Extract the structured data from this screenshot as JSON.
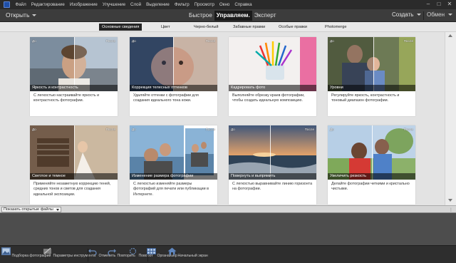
{
  "menubar": {
    "items": [
      "Файл",
      "Редактирование",
      "Изображение",
      "Улучшение",
      "Слой",
      "Выделение",
      "Фильтр",
      "Просмотр",
      "Окно",
      "Справка"
    ],
    "window_controls": [
      "–",
      "□",
      "✕"
    ]
  },
  "toolbar": {
    "open_label": "Открыть",
    "modes": [
      "Быстрое",
      "Управляем.",
      "Эксперт"
    ],
    "active_mode": "Управляем.",
    "create_label": "Создать",
    "share_label": "Обмен"
  },
  "tabs": [
    "Основные сведения",
    "Цвет",
    "Черно-белый",
    "Забавные правки",
    "Особые правки",
    "Photomerge"
  ],
  "active_tab": "Основные сведения",
  "cards": [
    {
      "title": "Яркость и контрастность",
      "desc": "С легкостью настраивайте яркость и контрастность фотографии.",
      "before": "До",
      "after": "После",
      "icon": "portrait-photo"
    },
    {
      "title": "Коррекция телесных оттенков",
      "desc": "Удаляйте оттенки с фотографии для создания идеального тона кожи.",
      "before": "До",
      "after": "После",
      "icon": "baby-photo"
    },
    {
      "title": "Кадрировать фото",
      "desc": "Выполняйте обрезку краев фотографии, чтобы создать идеальную композицию.",
      "before": "",
      "after": "",
      "icon": "pencils-photo"
    },
    {
      "title": "Уровни",
      "desc": "Регулируйте яркость, контрастность и тоновый диапазон фотографии.",
      "before": "До",
      "after": "После",
      "icon": "family-photo"
    },
    {
      "title": "Светлое и темное",
      "desc": "Применяйте незаметную коррекцию теней, средних тонов и светов для создания идеальной экспозиции.",
      "before": "До",
      "after": "После",
      "icon": "bride-photo"
    },
    {
      "title": "Изменение размера фотографии",
      "desc": "С легкостью изменяйте размеры фотографий для печати или публикации в Интернете.",
      "before": "До",
      "after": "После",
      "icon": "beach-photo"
    },
    {
      "title": "Повернуть и выпрямить",
      "desc": "С легкостью выравнивайте линию горизонта на фотографии.",
      "before": "До",
      "after": "После",
      "icon": "sunset-photo"
    },
    {
      "title": "Увеличить резкость",
      "desc": "Делайте фотографии четкими и кристально чистыми.",
      "before": "До",
      "after": "После",
      "icon": "kids-photo"
    }
  ],
  "filter": {
    "label": "Показать открытые файлы"
  },
  "taskbar": {
    "items": [
      {
        "label": "Подборка фотографий",
        "icon": "photo-bin-icon"
      },
      {
        "label": "Параметры инструмента",
        "icon": "tool-options-icon"
      },
      {
        "label": "Отменить",
        "icon": "undo-icon"
      },
      {
        "label": "Повторить",
        "icon": "redo-icon"
      },
      {
        "label": "Поворот",
        "icon": "rotate-icon"
      },
      {
        "label": "Органайзер",
        "icon": "organizer-icon"
      },
      {
        "label": "Начальный экран",
        "icon": "home-icon"
      }
    ]
  },
  "colors": {
    "accent_active": "#262626",
    "menubar": "#2b2b2b",
    "toolbar": "#3c3c3c",
    "main_bg": "#e3e3e3",
    "taskbar": "#2e2e2e"
  }
}
